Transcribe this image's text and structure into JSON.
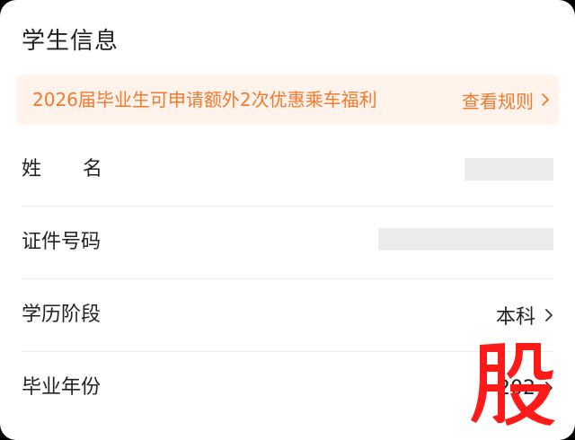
{
  "header": {
    "title": "学生信息"
  },
  "notice": {
    "text": "2026届毕业生可申请额外2次优惠乘车福利",
    "link_label": "查看规则",
    "color": "#f2792d",
    "background": "#fff3eb"
  },
  "fields": {
    "name_label": "姓名",
    "id_label": "证件号码",
    "education_label": "学历阶段",
    "education_value": "本科",
    "grad_year_label": "毕业年份",
    "grad_year_value": "202"
  },
  "watermark": {
    "glyph": "股",
    "color": "#ff1a1a"
  },
  "icons": {
    "chevron": "chevron-right-icon"
  }
}
